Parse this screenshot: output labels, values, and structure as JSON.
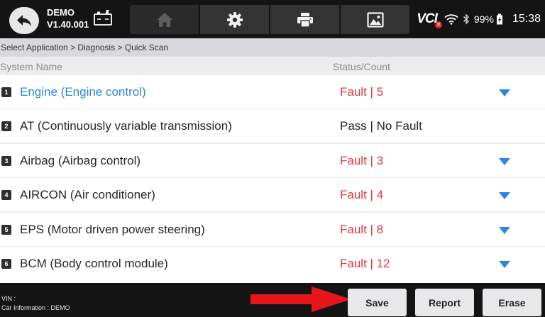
{
  "header": {
    "app_name": "DEMO",
    "version": "V1.40.001",
    "toolbar": [
      "home-icon",
      "gear-icon",
      "printer-icon",
      "image-icon"
    ],
    "vci_label": "VCI",
    "vci_status_color": "#d92b2b",
    "battery_percent": "99%",
    "time": "15:38"
  },
  "breadcrumb": "Select Application > Diagnosis > Quick Scan",
  "columns": {
    "system_name": "System Name",
    "status_count": "Status/Count"
  },
  "systems": [
    {
      "index": "1",
      "name": "Engine (Engine control)",
      "status": "Fault | 5",
      "fault": true,
      "expandable": true,
      "active": true
    },
    {
      "index": "2",
      "name": "AT (Continuously variable transmission)",
      "status": "Pass | No Fault",
      "fault": false,
      "expandable": false,
      "active": false
    },
    {
      "index": "3",
      "name": "Airbag (Airbag control)",
      "status": "Fault | 3",
      "fault": true,
      "expandable": true,
      "active": false
    },
    {
      "index": "4",
      "name": "AIRCON (Air conditioner)",
      "status": "Fault | 4",
      "fault": true,
      "expandable": true,
      "active": false
    },
    {
      "index": "5",
      "name": "EPS (Motor driven power steering)",
      "status": "Fault | 8",
      "fault": true,
      "expandable": true,
      "active": false
    },
    {
      "index": "6",
      "name": "BCM (Body control module)",
      "status": "Fault | 12",
      "fault": true,
      "expandable": true,
      "active": false
    }
  ],
  "footer": {
    "vin_label": "VIN :",
    "car_info": "Car Information : DEMO",
    "save_label": "Save",
    "report_label": "Report",
    "erase_label": "Erase"
  },
  "colors": {
    "fault": "#e0393e",
    "pass": "#262626",
    "active": "#2b86dc",
    "chevron": "#2b86dc",
    "annotation_arrow": "#e8161b"
  }
}
